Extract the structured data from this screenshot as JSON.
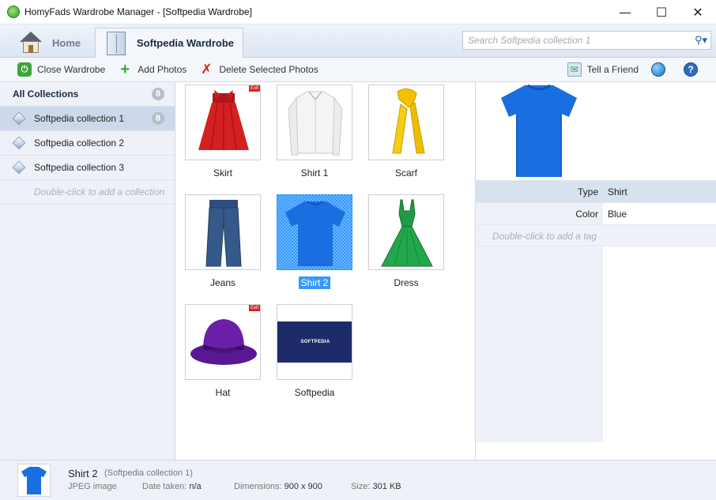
{
  "window": {
    "title": "HomyFads Wardrobe Manager - [Softpedia Wardrobe]",
    "minimize": "—",
    "maximize": "☐",
    "close": "✕"
  },
  "tabs": {
    "home_label": "Home",
    "wardrobe_label": "Softpedia Wardrobe"
  },
  "search": {
    "placeholder": "Search Softpedia collection 1",
    "icon": "search-icon"
  },
  "toolbar": {
    "close_wardrobe": "Close Wardrobe",
    "add_photos": "Add Photos",
    "delete_selected": "Delete Selected Photos",
    "tell_friend": "Tell a Friend"
  },
  "sidebar": {
    "header": {
      "label": "All Collections",
      "count": "8"
    },
    "items": [
      {
        "label": "Softpedia collection 1",
        "count": "8",
        "selected": true
      },
      {
        "label": "Softpedia collection 2"
      },
      {
        "label": "Softpedia collection 3"
      }
    ],
    "add_hint": "Double-click to add a collection"
  },
  "photos": [
    {
      "label": "Skirt",
      "exif": "Exif"
    },
    {
      "label": "Shirt 1"
    },
    {
      "label": "Scarf"
    },
    {
      "label": "Jeans"
    },
    {
      "label": "Shirt 2",
      "selected": true
    },
    {
      "label": "Dress"
    },
    {
      "label": "Hat",
      "exif": "Exif"
    },
    {
      "label": "Softpedia",
      "logo_text": "SOFTPEDIA"
    }
  ],
  "details": {
    "tags": [
      {
        "key": "Type",
        "value": "Shirt",
        "selected": true
      },
      {
        "key": "Color",
        "value": "Blue"
      }
    ],
    "add_hint": "Double-click to add a tag"
  },
  "status": {
    "name": "Shirt 2",
    "collection": "(Softpedia collection 1)",
    "type": "JPEG image",
    "date_label": "Date taken:",
    "date_value": "n/a",
    "dim_label": "Dimensions:",
    "dim_value": "900 x 900",
    "size_label": "Size:",
    "size_value": "301 KB"
  },
  "colors": {
    "accent": "#3399ff",
    "shirt_blue": "#1a6fe0",
    "skirt_red": "#d42020",
    "scarf_yellow": "#f2c200",
    "dress_green": "#1f9a45",
    "hat_purple": "#6a1fa8",
    "softpedia_navy": "#1e2b6b"
  }
}
